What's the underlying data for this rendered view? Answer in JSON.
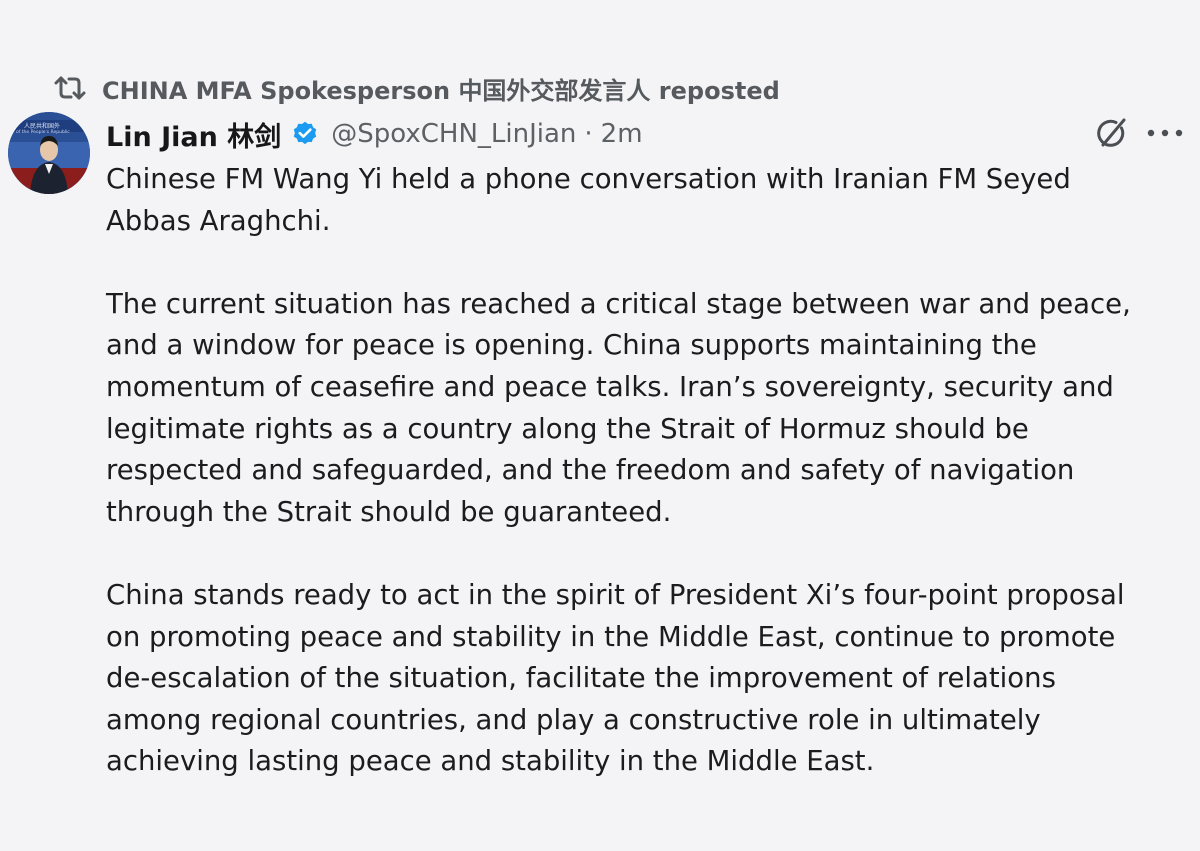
{
  "repost": {
    "text": "CHINA MFA Spokesperson 中国外交部发言人 reposted"
  },
  "author": {
    "display_name": "Lin Jian 林剑",
    "handle": "@SpoxCHN_LinJian",
    "separator": "·",
    "time": "2m"
  },
  "avatar_badge": {
    "line1": "人民共和国外",
    "line2": "of the People's Republic"
  },
  "icons": {
    "repost": "repost-icon",
    "verified": "verified-icon",
    "grok": "grok-icon",
    "more": "more-icon"
  },
  "colors": {
    "verified": "#1d9bf0",
    "muted_text": "#5d6065",
    "body_text": "#1c1c1f",
    "background": "#f4f4f6"
  },
  "tweet": {
    "para1": "Chinese FM Wang Yi held a phone conversation with Iranian FM Seyed\nAbbas Araghchi.",
    "para2": "The current situation has reached a critical stage between war and peace,\nand a window for peace is opening. China supports maintaining the\nmomentum of ceasefire and peace talks. Iran’s sovereignty, security and\nlegitimate rights as a country along the Strait of Hormuz should be\nrespected and safeguarded, and the freedom and safety of navigation\nthrough the Strait should be guaranteed.",
    "para3": "China stands ready to act in the spirit of President Xi’s four-point proposal\non promoting peace and stability in the Middle East, continue to promote\nde-escalation of the situation, facilitate the improvement of relations\namong regional countries, and play a constructive role in ultimately\nachieving lasting peace and stability in the Middle East."
  }
}
